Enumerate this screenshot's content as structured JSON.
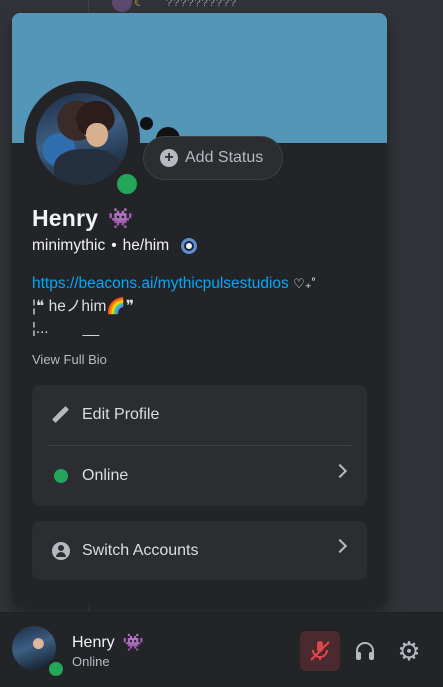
{
  "background": {
    "partial_text": "??????????"
  },
  "profile": {
    "add_status_label": "Add Status",
    "display_name": "Henry",
    "username": "minimythic",
    "separator": "•",
    "pronouns": "he/him",
    "bio": {
      "link": "https://beacons.ai/mythicpulsestudios",
      "link_suffix": "♡₊˚",
      "line2": "¦❝ heノhim🌈❞",
      "line3": "¦...",
      "line3_tail": "__"
    },
    "view_full_bio": "View Full Bio"
  },
  "menu": {
    "edit_profile": "Edit Profile",
    "status": "Online",
    "switch_accounts": "Switch Accounts"
  },
  "user_panel": {
    "name": "Henry",
    "status": "Online"
  },
  "colors": {
    "banner": "#5496b8",
    "online": "#23a55a",
    "link": "#00a8fc",
    "muted_button": "#4a2a2e",
    "muted_icon": "#e0464c"
  },
  "icons": {
    "name_badge": "space-invader-icon",
    "profile_badge": "ring-badge-icon",
    "mute": "microphone-muted-icon",
    "headset": "headset-icon",
    "settings": "gear-icon"
  }
}
